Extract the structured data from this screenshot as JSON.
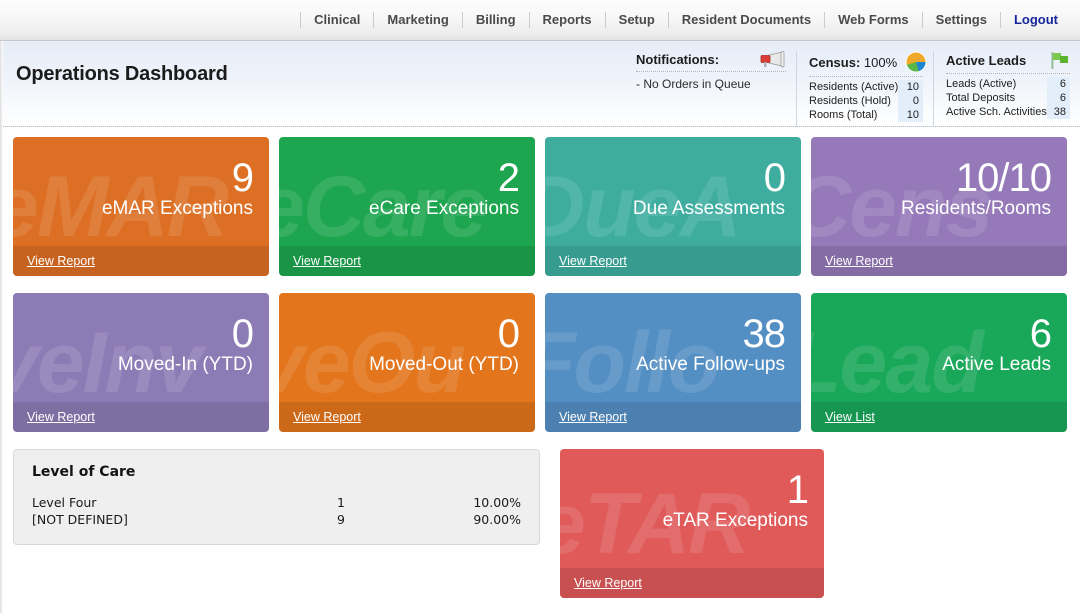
{
  "nav": {
    "items": [
      {
        "label": "Clinical",
        "accent": false
      },
      {
        "label": "Marketing",
        "accent": false
      },
      {
        "label": "Billing",
        "accent": false
      },
      {
        "label": "Reports",
        "accent": false
      },
      {
        "label": "Setup",
        "accent": false
      },
      {
        "label": "Resident Documents",
        "accent": false
      },
      {
        "label": "Web Forms",
        "accent": false
      },
      {
        "label": "Settings",
        "accent": false
      },
      {
        "label": "Logout",
        "accent": true
      }
    ]
  },
  "header": {
    "title": "Operations Dashboard",
    "notifications": {
      "title": "Notifications:",
      "icon": "megaphone-icon",
      "lines": [
        "- No Orders in Queue"
      ]
    },
    "census": {
      "title": "Census:",
      "percent": "100%",
      "icon": "pie-chart-icon",
      "rows": [
        {
          "label": "Residents (Active)",
          "value": "10"
        },
        {
          "label": "Residents (Hold)",
          "value": "0"
        },
        {
          "label": "Rooms (Total)",
          "value": "10"
        }
      ]
    },
    "active_leads": {
      "title": "Active Leads",
      "icon": "flag-icon",
      "rows": [
        {
          "label": "Leads (Active)",
          "value": "6"
        },
        {
          "label": "Total Deposits",
          "value": "6"
        },
        {
          "label": "Active Sch. Activities",
          "value": "38"
        }
      ]
    }
  },
  "tiles": {
    "row1": [
      {
        "value": "9",
        "label": "eMAR Exceptions",
        "link": "View Report",
        "watermark": "eMAR",
        "color": "#dd6f24"
      },
      {
        "value": "2",
        "label": "eCare Exceptions",
        "link": "View Report",
        "watermark": "eCare",
        "color": "#1da54f"
      },
      {
        "value": "0",
        "label": "Due Assessments",
        "link": "View Report",
        "watermark": "DueA",
        "color": "#3eada0"
      },
      {
        "value": "10/10",
        "label": "Residents/Rooms",
        "link": "View Report",
        "watermark": "Cens",
        "color": "#9579b8"
      }
    ],
    "row2": [
      {
        "value": "0",
        "label": "Moved-In (YTD)",
        "link": "View Report",
        "watermark": "veInv",
        "color": "#8d7bb5"
      },
      {
        "value": "0",
        "label": "Moved-Out (YTD)",
        "link": "View Report",
        "watermark": "veOu",
        "color": "#e3751c"
      },
      {
        "value": "38",
        "label": "Active Follow-ups",
        "link": "View Report",
        "watermark": "Follo",
        "color": "#548fc4"
      },
      {
        "value": "6",
        "label": "Active Leads",
        "link": "View List",
        "watermark": "Lead",
        "color": "#19a85a"
      }
    ],
    "etar": {
      "value": "1",
      "label": "eTAR Exceptions",
      "link": "View Report",
      "watermark": "eTAR",
      "color": "#e05a5a"
    }
  },
  "level_of_care": {
    "title": "Level of Care",
    "rows": [
      {
        "name": "Level Four",
        "count": "1",
        "percent": "10.00%"
      },
      {
        "name": "[NOT DEFINED]",
        "count": "9",
        "percent": "90.00%"
      }
    ]
  }
}
